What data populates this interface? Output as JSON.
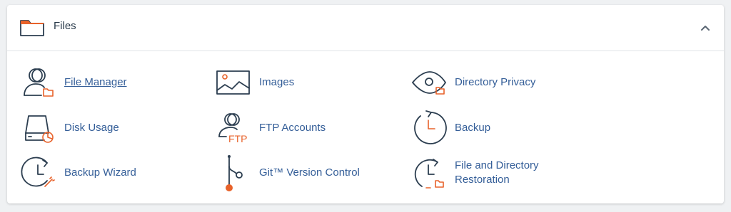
{
  "panel": {
    "title": "Files",
    "header_icon": "folder-icon",
    "collapse_icon": "chevron-up-icon"
  },
  "colors": {
    "link": "#345e98",
    "accent": "#e8622a",
    "icon_stroke": "#2c3e50"
  },
  "items": [
    {
      "label": "File Manager",
      "icon": "file-manager-icon"
    },
    {
      "label": "Images",
      "icon": "images-icon"
    },
    {
      "label": "Directory Privacy",
      "icon": "directory-privacy-icon"
    },
    {
      "label": "Disk Usage",
      "icon": "disk-usage-icon"
    },
    {
      "label": "FTP Accounts",
      "icon": "ftp-accounts-icon",
      "icon_text": "FTP"
    },
    {
      "label": "Backup",
      "icon": "backup-icon"
    },
    {
      "label": "Backup Wizard",
      "icon": "backup-wizard-icon"
    },
    {
      "label": "Git™ Version Control",
      "icon": "git-version-control-icon"
    },
    {
      "label": "File and Directory Restoration",
      "icon": "file-restoration-icon"
    }
  ]
}
